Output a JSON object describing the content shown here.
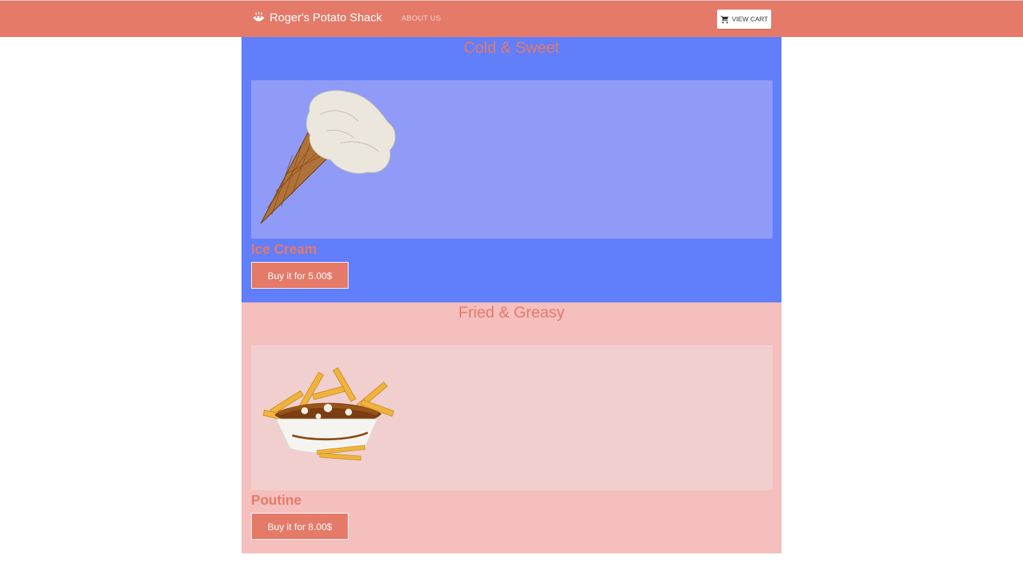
{
  "header": {
    "brand_icon": "potato-bowl-icon",
    "brand_name": "Roger's Potato Shack",
    "nav_about": "ABOUT US",
    "cart_icon": "cart-icon",
    "cart_label": "VIEW CART"
  },
  "sections": [
    {
      "title": "Cold & Sweet",
      "item": {
        "image": "ice-cream-cone-image",
        "name": "Ice Cream",
        "buy_label": "Buy it for 5.00$"
      }
    },
    {
      "title": "Fried & Greasy",
      "item": {
        "image": "poutine-image",
        "name": "Poutine",
        "buy_label": "Buy it for 8.00$"
      }
    }
  ],
  "colors": {
    "accent": "#e57a69",
    "cold_bg": "#617efb",
    "cold_image_bg": "#8f9bf7",
    "fried_bg": "#f4bfbd",
    "fried_image_bg": "#f0cfce"
  }
}
